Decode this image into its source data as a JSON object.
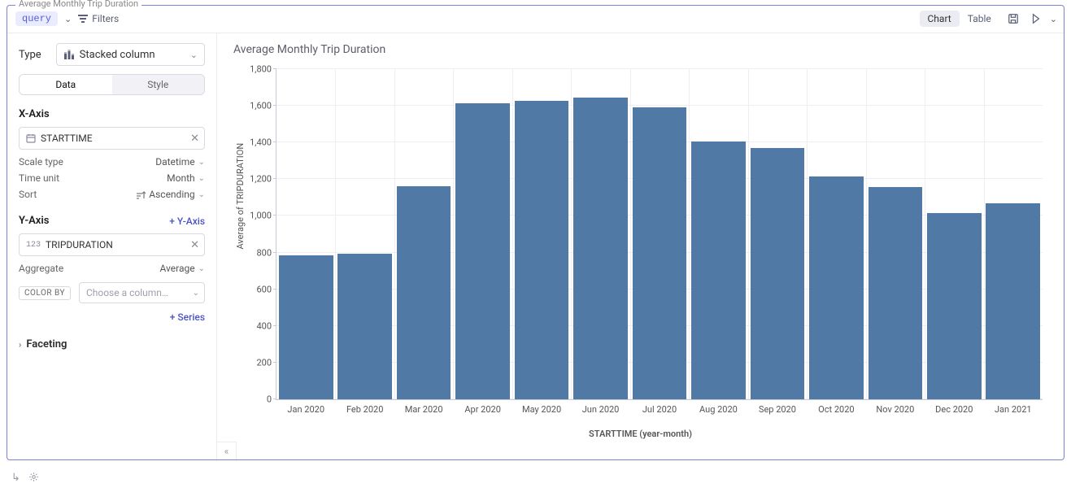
{
  "cell_title": "Average Monthly Trip Duration",
  "toolbar": {
    "query_chip": "query",
    "filters_label": "Filters",
    "view_chart": "Chart",
    "view_table": "Table"
  },
  "config": {
    "type_label": "Type",
    "chart_type": "Stacked column",
    "tab_data": "Data",
    "tab_style": "Style",
    "xaxis": {
      "title": "X-Axis",
      "field": "STARTTIME",
      "scale_label": "Scale type",
      "scale_value": "Datetime",
      "unit_label": "Time unit",
      "unit_value": "Month",
      "sort_label": "Sort",
      "sort_value": "Ascending"
    },
    "yaxis": {
      "title": "Y-Axis",
      "add_label": "+ Y-Axis",
      "field": "TRIPDURATION",
      "agg_label": "Aggregate",
      "agg_value": "Average"
    },
    "color_by_label": "COLOR BY",
    "color_by_placeholder": "Choose a column…",
    "add_series": "+ Series",
    "faceting": "Faceting"
  },
  "chart_data": {
    "type": "bar",
    "title": "Average Monthly Trip Duration",
    "xlabel": "STARTTIME (year-month)",
    "ylabel": "Average of TRIPDURATION",
    "ylim": [
      0,
      1800
    ],
    "yticks": [
      0,
      200,
      400,
      600,
      800,
      1000,
      1200,
      1400,
      1600,
      1800
    ],
    "categories": [
      "Jan 2020",
      "Feb 2020",
      "Mar 2020",
      "Apr 2020",
      "May 2020",
      "Jun 2020",
      "Jul 2020",
      "Aug 2020",
      "Sep 2020",
      "Oct 2020",
      "Nov 2020",
      "Dec 2020",
      "Jan 2021"
    ],
    "values": [
      785,
      795,
      1160,
      1615,
      1625,
      1645,
      1590,
      1405,
      1370,
      1215,
      1155,
      1015,
      1070
    ]
  }
}
